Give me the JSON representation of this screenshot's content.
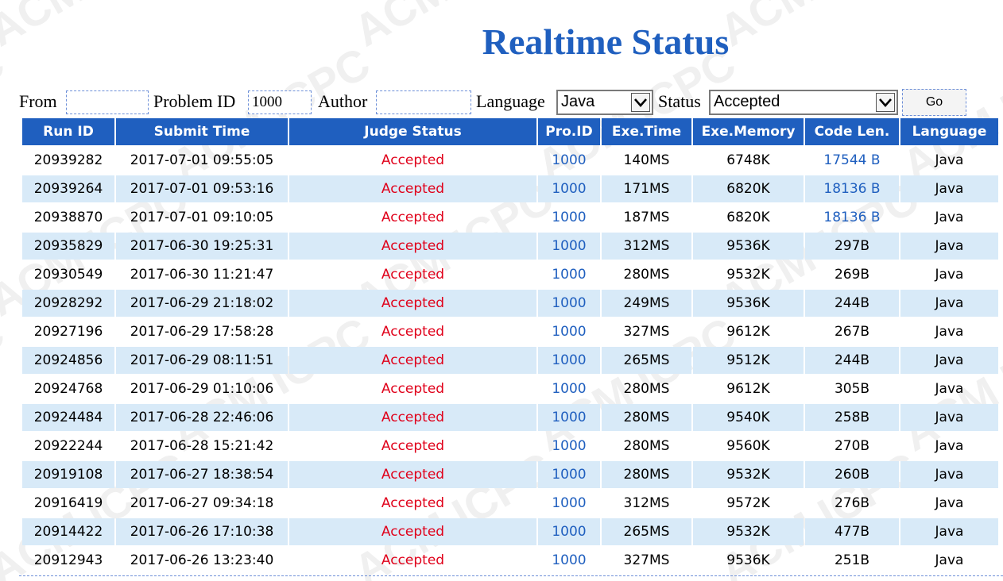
{
  "page": {
    "title": "Realtime Status",
    "watermark": "ACM ICPC"
  },
  "filters": {
    "from_label": "From",
    "from_value": "",
    "problem_id_label": "Problem ID",
    "problem_id_value": "1000",
    "author_label": "Author",
    "author_value": "",
    "language_label": "Language",
    "language_value": "Java",
    "status_label": "Status",
    "status_value": "Accepted",
    "go_label": "Go"
  },
  "table": {
    "headers": [
      "Run ID",
      "Submit Time",
      "Judge Status",
      "Pro.ID",
      "Exe.Time",
      "Exe.Memory",
      "Code Len.",
      "Language"
    ],
    "rows": [
      {
        "run_id": "20939282",
        "submit_time": "2017-07-01 09:55:05",
        "judge_status": "Accepted",
        "pro_id": "1000",
        "exe_time": "140MS",
        "exe_memory": "6748K",
        "code_len": "17544 B",
        "language": "Java"
      },
      {
        "run_id": "20939264",
        "submit_time": "2017-07-01 09:53:16",
        "judge_status": "Accepted",
        "pro_id": "1000",
        "exe_time": "171MS",
        "exe_memory": "6820K",
        "code_len": "18136 B",
        "language": "Java"
      },
      {
        "run_id": "20938870",
        "submit_time": "2017-07-01 09:10:05",
        "judge_status": "Accepted",
        "pro_id": "1000",
        "exe_time": "187MS",
        "exe_memory": "6820K",
        "code_len": "18136 B",
        "language": "Java"
      },
      {
        "run_id": "20935829",
        "submit_time": "2017-06-30 19:25:31",
        "judge_status": "Accepted",
        "pro_id": "1000",
        "exe_time": "312MS",
        "exe_memory": "9536K",
        "code_len": "297B",
        "language": "Java"
      },
      {
        "run_id": "20930549",
        "submit_time": "2017-06-30 11:21:47",
        "judge_status": "Accepted",
        "pro_id": "1000",
        "exe_time": "280MS",
        "exe_memory": "9532K",
        "code_len": "269B",
        "language": "Java"
      },
      {
        "run_id": "20928292",
        "submit_time": "2017-06-29 21:18:02",
        "judge_status": "Accepted",
        "pro_id": "1000",
        "exe_time": "249MS",
        "exe_memory": "9536K",
        "code_len": "244B",
        "language": "Java"
      },
      {
        "run_id": "20927196",
        "submit_time": "2017-06-29 17:58:28",
        "judge_status": "Accepted",
        "pro_id": "1000",
        "exe_time": "327MS",
        "exe_memory": "9612K",
        "code_len": "267B",
        "language": "Java"
      },
      {
        "run_id": "20924856",
        "submit_time": "2017-06-29 08:11:51",
        "judge_status": "Accepted",
        "pro_id": "1000",
        "exe_time": "265MS",
        "exe_memory": "9512K",
        "code_len": "244B",
        "language": "Java"
      },
      {
        "run_id": "20924768",
        "submit_time": "2017-06-29 01:10:06",
        "judge_status": "Accepted",
        "pro_id": "1000",
        "exe_time": "280MS",
        "exe_memory": "9612K",
        "code_len": "305B",
        "language": "Java"
      },
      {
        "run_id": "20924484",
        "submit_time": "2017-06-28 22:46:06",
        "judge_status": "Accepted",
        "pro_id": "1000",
        "exe_time": "280MS",
        "exe_memory": "9540K",
        "code_len": "258B",
        "language": "Java"
      },
      {
        "run_id": "20922244",
        "submit_time": "2017-06-28 15:21:42",
        "judge_status": "Accepted",
        "pro_id": "1000",
        "exe_time": "280MS",
        "exe_memory": "9560K",
        "code_len": "270B",
        "language": "Java"
      },
      {
        "run_id": "20919108",
        "submit_time": "2017-06-27 18:38:54",
        "judge_status": "Accepted",
        "pro_id": "1000",
        "exe_time": "280MS",
        "exe_memory": "9532K",
        "code_len": "260B",
        "language": "Java"
      },
      {
        "run_id": "20916419",
        "submit_time": "2017-06-27 09:34:18",
        "judge_status": "Accepted",
        "pro_id": "1000",
        "exe_time": "312MS",
        "exe_memory": "9572K",
        "code_len": "276B",
        "language": "Java"
      },
      {
        "run_id": "20914422",
        "submit_time": "2017-06-26 17:10:38",
        "judge_status": "Accepted",
        "pro_id": "1000",
        "exe_time": "265MS",
        "exe_memory": "9532K",
        "code_len": "477B",
        "language": "Java"
      },
      {
        "run_id": "20912943",
        "submit_time": "2017-06-26 13:23:40",
        "judge_status": "Accepted",
        "pro_id": "1000",
        "exe_time": "327MS",
        "exe_memory": "9536K",
        "code_len": "251B",
        "language": "Java"
      }
    ]
  },
  "colors": {
    "header_bg": "#1f5fbf",
    "row_alt_bg": "#d8eaf8",
    "accepted": "#e0001a",
    "link": "#1f5fbf"
  }
}
